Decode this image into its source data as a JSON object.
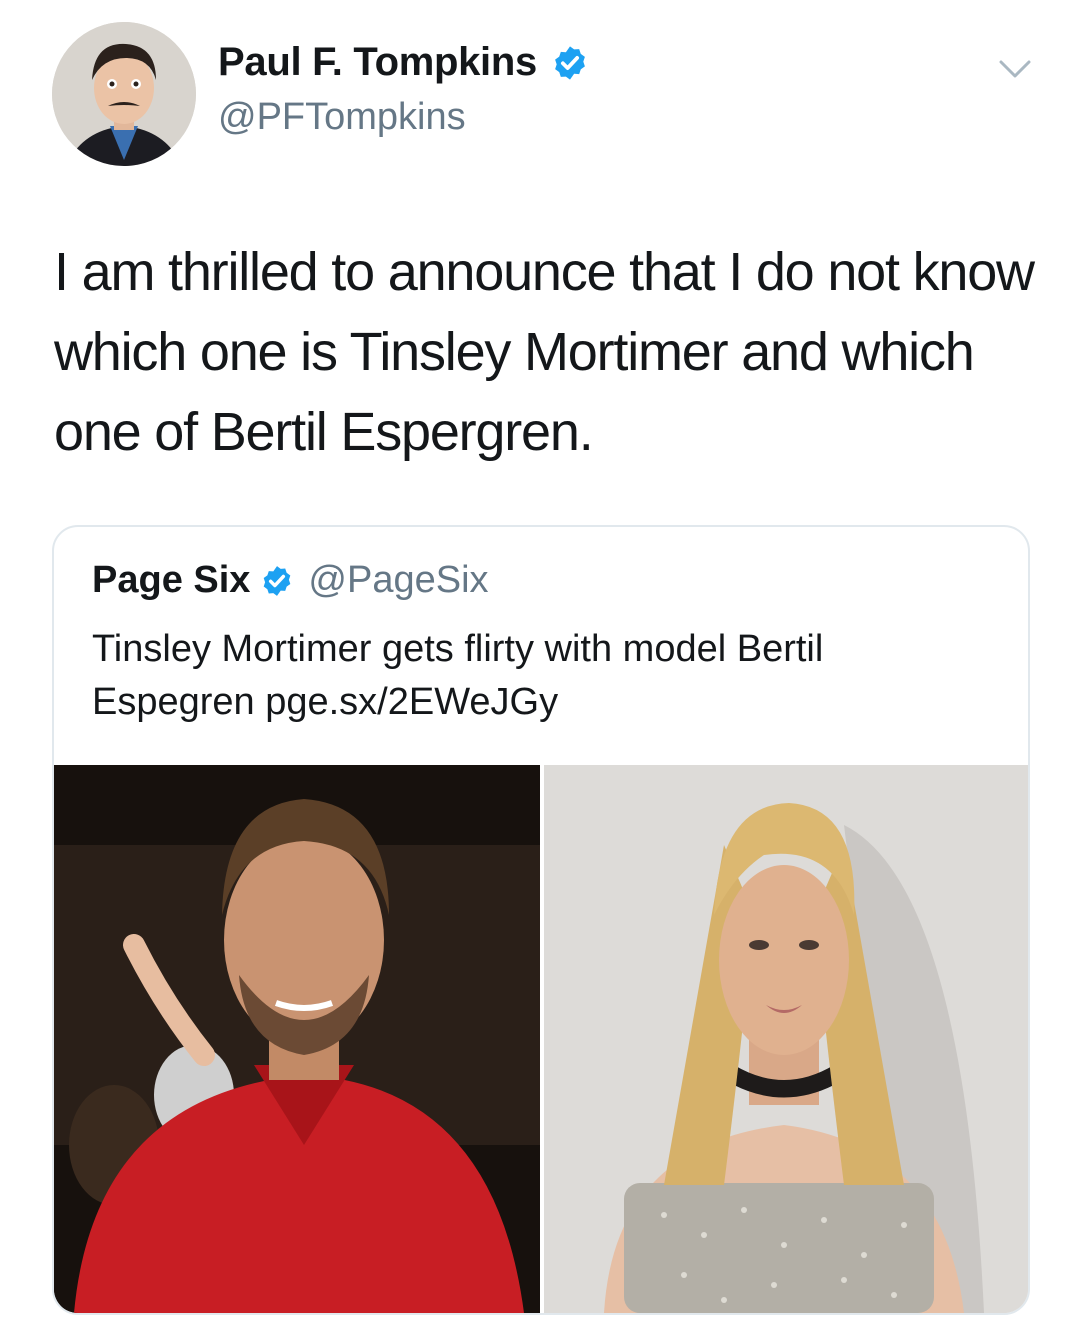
{
  "author": {
    "name": "Paul F. Tompkins",
    "handle": "@PFTompkins"
  },
  "tweet": {
    "text": "I am thrilled to announce that I do not know which one is Tinsley Mortimer and which one of Bertil Espergren."
  },
  "quoted_tweet": {
    "name": "Page Six",
    "handle": "@PageSix",
    "text": "Tinsley Mortimer gets flirty with model Bertil Espegren pge.sx/2EWeJGy"
  },
  "icons": {
    "verified": "verified-badge-icon",
    "menu": "chevron-down-icon"
  },
  "colors": {
    "verified_blue": "#1da1f2",
    "secondary_text": "#657786",
    "primary_text": "#14171a",
    "card_border": "#e1e8ed"
  }
}
